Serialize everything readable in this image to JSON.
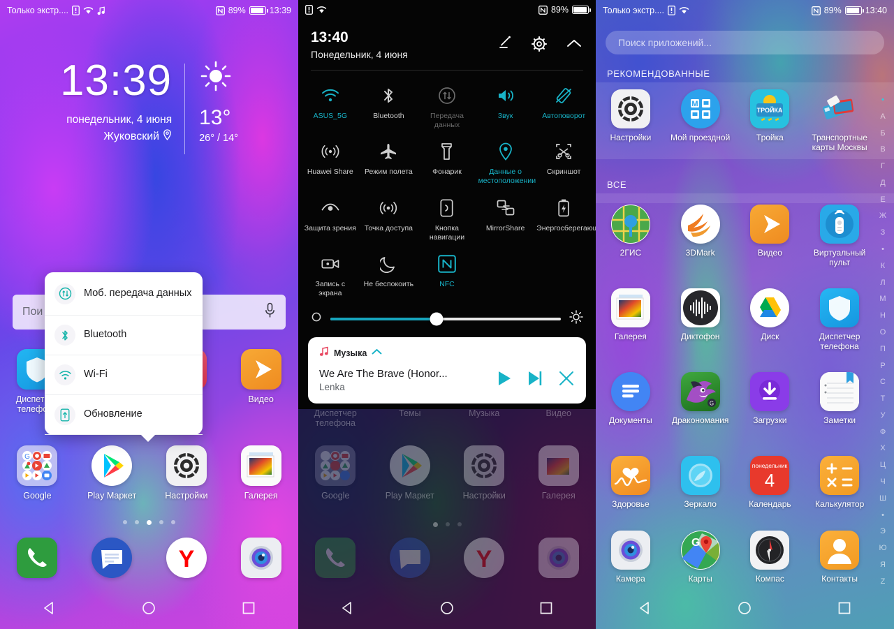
{
  "panel1": {
    "statusbar": {
      "carrier": "Только экстр....",
      "icons": [
        "sim-alert-icon",
        "wifi-icon",
        "music-note-icon",
        "nfc-icon"
      ],
      "battery": "89%",
      "time": "13:39"
    },
    "clock": {
      "time": "13:39",
      "date": "понедельник, 4 июня",
      "city": "Жуковский"
    },
    "weather": {
      "icon": "sun-icon",
      "temp": "13°",
      "range": "26° / 14°"
    },
    "search": {
      "placeholder": "Пои"
    },
    "popup": {
      "items": [
        {
          "label": "Моб. передача данных",
          "icon": "data-transfer-icon"
        },
        {
          "label": "Bluetooth",
          "icon": "bluetooth-icon"
        },
        {
          "label": "Wi-Fi",
          "icon": "wifi-icon"
        },
        {
          "label": "Обновление",
          "icon": "update-icon"
        }
      ]
    },
    "row_upper": [
      {
        "label": "Диспетчер телефона",
        "icon": "phone-manager-icon"
      },
      {
        "label": "",
        "icon": "themes-icon"
      },
      {
        "label": "",
        "icon": "music-icon"
      },
      {
        "label": "Видео",
        "icon": "video-icon"
      }
    ],
    "row_main": [
      {
        "label": "Google",
        "icon": "google-folder-icon"
      },
      {
        "label": "Play Маркет",
        "icon": "play-store-icon"
      },
      {
        "label": "Настройки",
        "icon": "settings-icon"
      },
      {
        "label": "Галерея",
        "icon": "gallery-icon"
      }
    ],
    "pager": {
      "count": 5,
      "active": 2
    },
    "dock": [
      {
        "label": "",
        "icon": "phone-icon"
      },
      {
        "label": "",
        "icon": "messages-icon"
      },
      {
        "label": "",
        "icon": "yandex-icon"
      },
      {
        "label": "",
        "icon": "camera-icon"
      }
    ],
    "nav": [
      "back-icon",
      "home-icon",
      "recents-icon"
    ]
  },
  "panel2": {
    "statusbar": {
      "carrier": "",
      "icons": [
        "sim-alert-icon",
        "wifi-icon",
        "nfc-icon"
      ],
      "battery": "89%",
      "time": ""
    },
    "shade": {
      "time": "13:40",
      "date": "Понедельник, 4 июня",
      "actions": [
        "edit-icon",
        "gear-icon",
        "collapse-icon"
      ]
    },
    "tiles": [
      {
        "label": "ASUS_5G",
        "icon": "wifi-icon",
        "state": "on"
      },
      {
        "label": "Bluetooth",
        "icon": "bluetooth-icon",
        "state": "off"
      },
      {
        "label": "Передача данных",
        "icon": "data-transfer-icon",
        "state": "disabled"
      },
      {
        "label": "Звук",
        "icon": "sound-icon",
        "state": "on"
      },
      {
        "label": "Автоповорот",
        "icon": "autorotate-icon",
        "state": "on"
      },
      {
        "label": "Huawei Share",
        "icon": "huawei-share-icon",
        "state": "off"
      },
      {
        "label": "Режим полета",
        "icon": "airplane-icon",
        "state": "off"
      },
      {
        "label": "Фонарик",
        "icon": "flashlight-icon",
        "state": "off"
      },
      {
        "label": "Данные о местоположении",
        "icon": "location-icon",
        "state": "on"
      },
      {
        "label": "Скриншот",
        "icon": "screenshot-icon",
        "state": "off"
      },
      {
        "label": "Защита зрения",
        "icon": "eye-comfort-icon",
        "state": "off"
      },
      {
        "label": "Точка доступа",
        "icon": "hotspot-icon",
        "state": "off"
      },
      {
        "label": "Кнопка навигации",
        "icon": "nav-button-icon",
        "state": "off"
      },
      {
        "label": "MirrorShare",
        "icon": "mirrorshare-icon",
        "state": "off"
      },
      {
        "label": "Энергосберегающий",
        "icon": "battery-saver-icon",
        "state": "off"
      },
      {
        "label": "Запись с экрана",
        "icon": "screen-record-icon",
        "state": "off"
      },
      {
        "label": "Не беспокоить",
        "icon": "do-not-disturb-icon",
        "state": "off"
      },
      {
        "label": "NFC",
        "icon": "nfc-icon",
        "state": "on"
      }
    ],
    "brightness": {
      "auto_icon": "auto-brightness-icon",
      "value": 46,
      "sun_icon": "brightness-icon"
    },
    "notification": {
      "app": "Музыка",
      "app_icon": "music-note-icon",
      "collapse_icon": "collapse-icon",
      "title": "We Are The Brave (Honor...",
      "artist": "Lenka",
      "controls": [
        "play-icon",
        "next-icon",
        "close-icon"
      ]
    },
    "bg_row_labels": [
      "Диспетчер телефона",
      "Темы",
      "Музыка",
      "Видео"
    ],
    "bg_row_main": [
      "Google",
      "Play Маркет",
      "Настройки",
      "Галерея"
    ],
    "pager": {
      "count": 3,
      "active": 0
    },
    "nav": [
      "back-icon",
      "home-icon",
      "recents-icon"
    ]
  },
  "panel3": {
    "statusbar": {
      "carrier": "Только экстр....",
      "icons": [
        "sim-alert-icon",
        "wifi-icon",
        "nfc-icon"
      ],
      "battery": "89%",
      "time": "13:40"
    },
    "search": {
      "placeholder": "Поиск приложений..."
    },
    "sections": [
      {
        "title": "РЕКОМЕНДОВАННЫЕ",
        "apps": [
          {
            "label": "Настройки",
            "icon": "settings-icon"
          },
          {
            "label": "Мой проездной",
            "icon": "moy-proezdnoy-icon"
          },
          {
            "label": "Тройка",
            "icon": "troika-icon"
          },
          {
            "label": "Транспортные карты Москвы",
            "icon": "transport-cards-icon"
          }
        ]
      },
      {
        "title": "ВСЕ",
        "apps": [
          {
            "label": "2ГИС",
            "icon": "2gis-icon"
          },
          {
            "label": "3DMark",
            "icon": "3dmark-icon"
          },
          {
            "label": "Видео",
            "icon": "video-icon"
          },
          {
            "label": "Виртуальный пульт",
            "icon": "remote-icon"
          },
          {
            "label": "Галерея",
            "icon": "gallery-icon"
          },
          {
            "label": "Диктофон",
            "icon": "recorder-icon"
          },
          {
            "label": "Диск",
            "icon": "google-drive-icon"
          },
          {
            "label": "Диспетчер телефона",
            "icon": "phone-manager-icon"
          },
          {
            "label": "Документы",
            "icon": "google-docs-icon"
          },
          {
            "label": "Драконома­ния",
            "icon": "dragon-mania-icon"
          },
          {
            "label": "Загрузки",
            "icon": "downloads-icon"
          },
          {
            "label": "Заметки",
            "icon": "notes-icon"
          },
          {
            "label": "Здоровье",
            "icon": "health-icon"
          },
          {
            "label": "Зеркало",
            "icon": "mirror-icon"
          },
          {
            "label": "Календарь",
            "icon": "calendar-icon"
          },
          {
            "label": "Калькулятор",
            "icon": "calculator-icon"
          },
          {
            "label": "Камера",
            "icon": "camera-icon"
          },
          {
            "label": "Карты",
            "icon": "google-maps-icon"
          },
          {
            "label": "Компас",
            "icon": "compass-icon"
          },
          {
            "label": "Контакты",
            "icon": "contacts-icon"
          }
        ]
      }
    ],
    "calendar_icon": {
      "weekday": "понедельник",
      "day": "4"
    },
    "alphabet": [
      "•",
      "А",
      "Б",
      "В",
      "Г",
      "Д",
      "Е",
      "Ж",
      "З",
      "•",
      "К",
      "Л",
      "М",
      "Н",
      "О",
      "П",
      "Р",
      "С",
      "Т",
      "У",
      "Ф",
      "Х",
      "Ц",
      "Ч",
      "Ш",
      "•",
      "Э",
      "Ю",
      "Я",
      "Z"
    ],
    "nav": [
      "back-icon",
      "home-icon",
      "recents-icon"
    ]
  },
  "colors": {
    "accent_teal": "#18b3c7",
    "shade_bg": "#050505",
    "tile_off": "#cfcfcf",
    "tile_disabled": "#6a6a6a"
  }
}
